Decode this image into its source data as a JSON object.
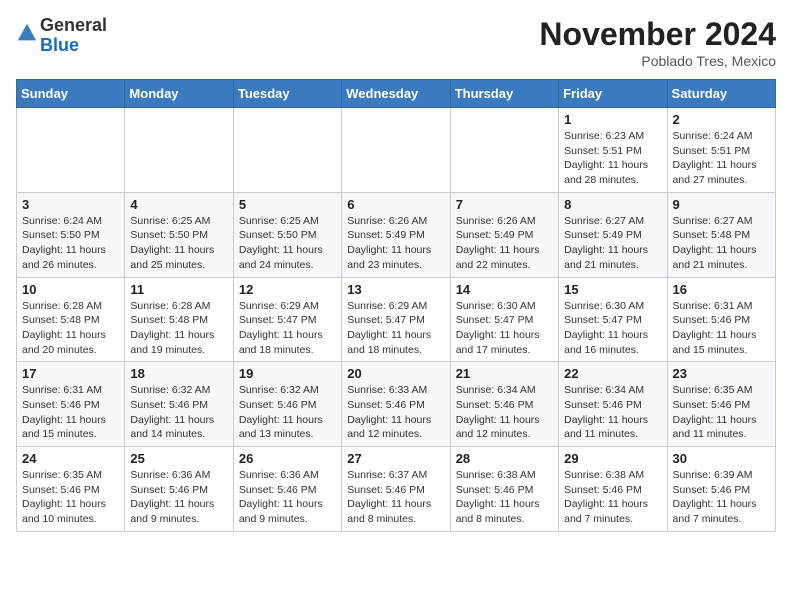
{
  "logo": {
    "general": "General",
    "blue": "Blue"
  },
  "title": "November 2024",
  "location": "Poblado Tres, Mexico",
  "days_header": [
    "Sunday",
    "Monday",
    "Tuesday",
    "Wednesday",
    "Thursday",
    "Friday",
    "Saturday"
  ],
  "weeks": [
    [
      {
        "day": "",
        "info": ""
      },
      {
        "day": "",
        "info": ""
      },
      {
        "day": "",
        "info": ""
      },
      {
        "day": "",
        "info": ""
      },
      {
        "day": "",
        "info": ""
      },
      {
        "day": "1",
        "info": "Sunrise: 6:23 AM\nSunset: 5:51 PM\nDaylight: 11 hours\nand 28 minutes."
      },
      {
        "day": "2",
        "info": "Sunrise: 6:24 AM\nSunset: 5:51 PM\nDaylight: 11 hours\nand 27 minutes."
      }
    ],
    [
      {
        "day": "3",
        "info": "Sunrise: 6:24 AM\nSunset: 5:50 PM\nDaylight: 11 hours\nand 26 minutes."
      },
      {
        "day": "4",
        "info": "Sunrise: 6:25 AM\nSunset: 5:50 PM\nDaylight: 11 hours\nand 25 minutes."
      },
      {
        "day": "5",
        "info": "Sunrise: 6:25 AM\nSunset: 5:50 PM\nDaylight: 11 hours\nand 24 minutes."
      },
      {
        "day": "6",
        "info": "Sunrise: 6:26 AM\nSunset: 5:49 PM\nDaylight: 11 hours\nand 23 minutes."
      },
      {
        "day": "7",
        "info": "Sunrise: 6:26 AM\nSunset: 5:49 PM\nDaylight: 11 hours\nand 22 minutes."
      },
      {
        "day": "8",
        "info": "Sunrise: 6:27 AM\nSunset: 5:49 PM\nDaylight: 11 hours\nand 21 minutes."
      },
      {
        "day": "9",
        "info": "Sunrise: 6:27 AM\nSunset: 5:48 PM\nDaylight: 11 hours\nand 21 minutes."
      }
    ],
    [
      {
        "day": "10",
        "info": "Sunrise: 6:28 AM\nSunset: 5:48 PM\nDaylight: 11 hours\nand 20 minutes."
      },
      {
        "day": "11",
        "info": "Sunrise: 6:28 AM\nSunset: 5:48 PM\nDaylight: 11 hours\nand 19 minutes."
      },
      {
        "day": "12",
        "info": "Sunrise: 6:29 AM\nSunset: 5:47 PM\nDaylight: 11 hours\nand 18 minutes."
      },
      {
        "day": "13",
        "info": "Sunrise: 6:29 AM\nSunset: 5:47 PM\nDaylight: 11 hours\nand 18 minutes."
      },
      {
        "day": "14",
        "info": "Sunrise: 6:30 AM\nSunset: 5:47 PM\nDaylight: 11 hours\nand 17 minutes."
      },
      {
        "day": "15",
        "info": "Sunrise: 6:30 AM\nSunset: 5:47 PM\nDaylight: 11 hours\nand 16 minutes."
      },
      {
        "day": "16",
        "info": "Sunrise: 6:31 AM\nSunset: 5:46 PM\nDaylight: 11 hours\nand 15 minutes."
      }
    ],
    [
      {
        "day": "17",
        "info": "Sunrise: 6:31 AM\nSunset: 5:46 PM\nDaylight: 11 hours\nand 15 minutes."
      },
      {
        "day": "18",
        "info": "Sunrise: 6:32 AM\nSunset: 5:46 PM\nDaylight: 11 hours\nand 14 minutes."
      },
      {
        "day": "19",
        "info": "Sunrise: 6:32 AM\nSunset: 5:46 PM\nDaylight: 11 hours\nand 13 minutes."
      },
      {
        "day": "20",
        "info": "Sunrise: 6:33 AM\nSunset: 5:46 PM\nDaylight: 11 hours\nand 12 minutes."
      },
      {
        "day": "21",
        "info": "Sunrise: 6:34 AM\nSunset: 5:46 PM\nDaylight: 11 hours\nand 12 minutes."
      },
      {
        "day": "22",
        "info": "Sunrise: 6:34 AM\nSunset: 5:46 PM\nDaylight: 11 hours\nand 11 minutes."
      },
      {
        "day": "23",
        "info": "Sunrise: 6:35 AM\nSunset: 5:46 PM\nDaylight: 11 hours\nand 11 minutes."
      }
    ],
    [
      {
        "day": "24",
        "info": "Sunrise: 6:35 AM\nSunset: 5:46 PM\nDaylight: 11 hours\nand 10 minutes."
      },
      {
        "day": "25",
        "info": "Sunrise: 6:36 AM\nSunset: 5:46 PM\nDaylight: 11 hours\nand 9 minutes."
      },
      {
        "day": "26",
        "info": "Sunrise: 6:36 AM\nSunset: 5:46 PM\nDaylight: 11 hours\nand 9 minutes."
      },
      {
        "day": "27",
        "info": "Sunrise: 6:37 AM\nSunset: 5:46 PM\nDaylight: 11 hours\nand 8 minutes."
      },
      {
        "day": "28",
        "info": "Sunrise: 6:38 AM\nSunset: 5:46 PM\nDaylight: 11 hours\nand 8 minutes."
      },
      {
        "day": "29",
        "info": "Sunrise: 6:38 AM\nSunset: 5:46 PM\nDaylight: 11 hours\nand 7 minutes."
      },
      {
        "day": "30",
        "info": "Sunrise: 6:39 AM\nSunset: 5:46 PM\nDaylight: 11 hours\nand 7 minutes."
      }
    ]
  ]
}
